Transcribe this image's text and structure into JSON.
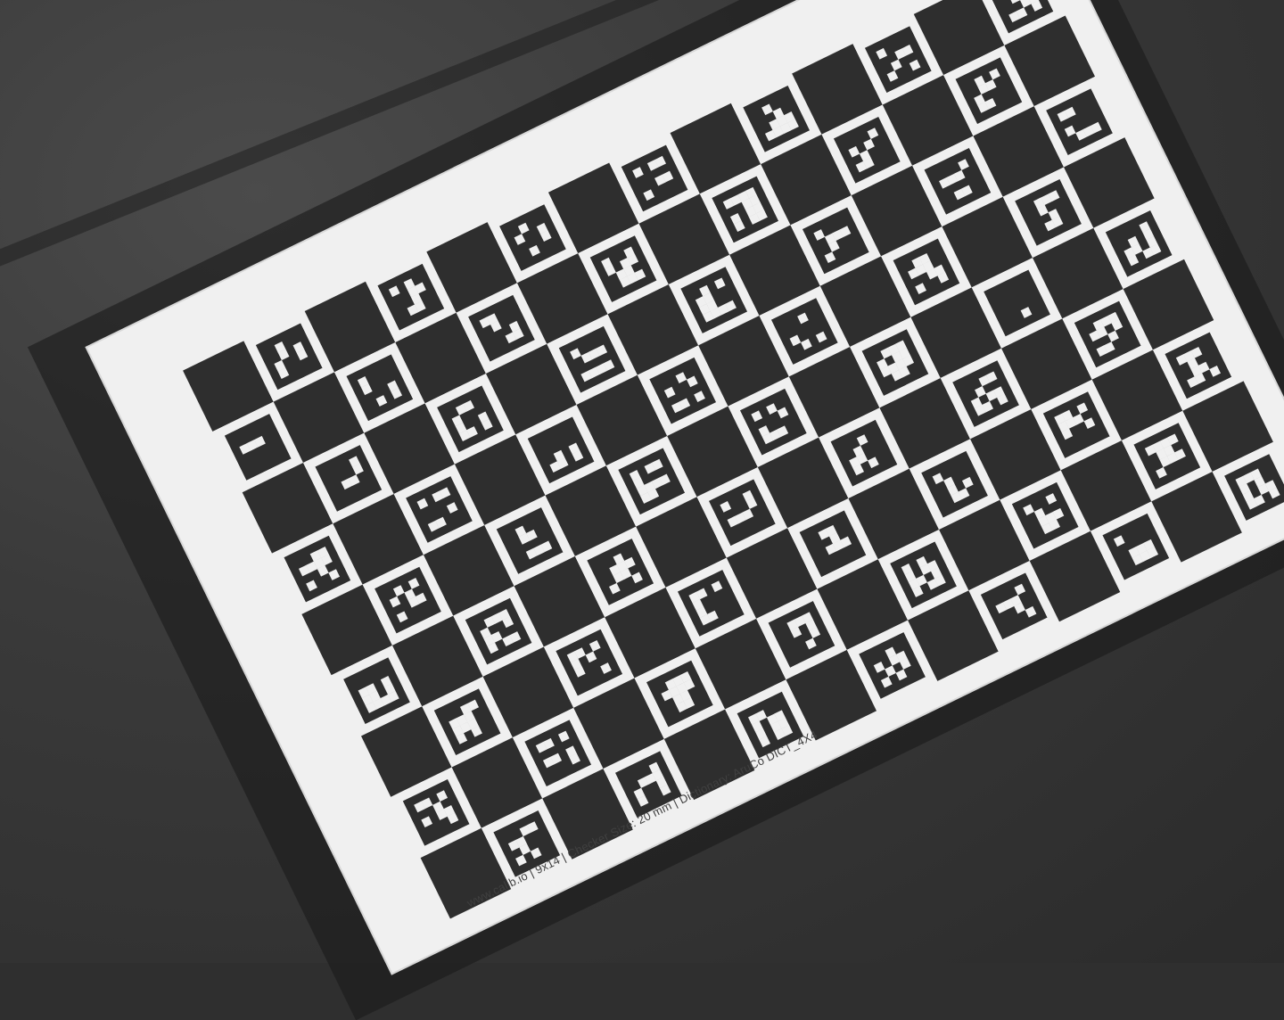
{
  "scene": {
    "type": "photo",
    "description_label": "ChArUco calibration board on a table",
    "board": {
      "rows": 9,
      "cols": 14,
      "footer_text": "www.calib.io | 9x14 | Checker Size: 20 mm | Dictionary: AruCo DICT_4X4"
    },
    "colors": {
      "background": "#2f2f2f",
      "paper": "#f0f0f0",
      "dark_square": "#2e2e2e"
    }
  }
}
